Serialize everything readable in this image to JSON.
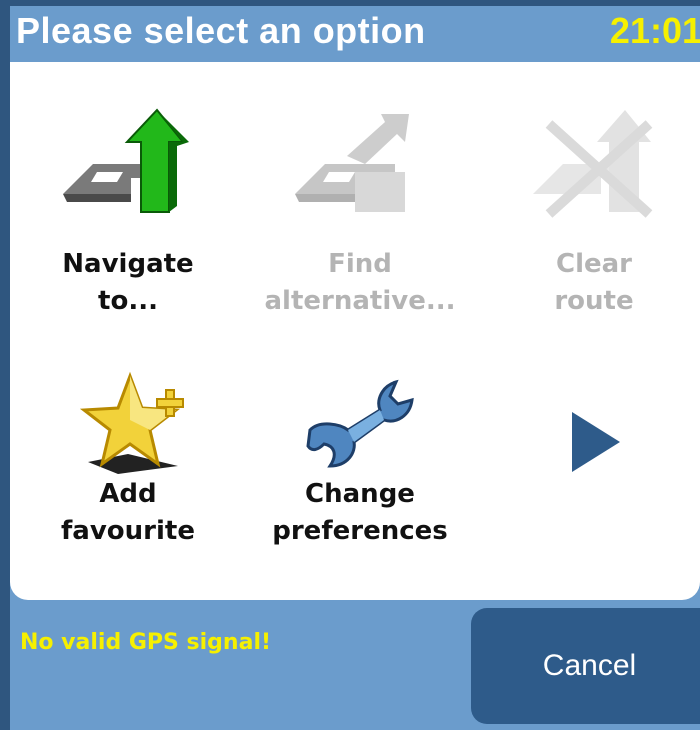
{
  "header": {
    "title": "Please select an option",
    "time": "21:01"
  },
  "menu": {
    "items": [
      {
        "line1": "Navigate",
        "line2": "to...",
        "icon": "navigate-arrow-icon",
        "enabled": true
      },
      {
        "line1": "Find",
        "line2": "alternative...",
        "icon": "find-alternative-icon",
        "enabled": false
      },
      {
        "line1": "Clear",
        "line2": "route",
        "icon": "clear-route-icon",
        "enabled": false
      },
      {
        "line1": "Add",
        "line2": "favourite",
        "icon": "star-plus-icon",
        "enabled": true
      },
      {
        "line1": "Change",
        "line2": "preferences",
        "icon": "wrench-icon",
        "enabled": true
      }
    ],
    "next_icon": "next-page-arrow-icon"
  },
  "status": {
    "message": "No valid GPS signal!"
  },
  "footer": {
    "cancel_label": "Cancel"
  },
  "colors": {
    "header_bg": "#6b9ccc",
    "clock": "#f6f000",
    "cancel_bg": "#2e5b8a",
    "status_text": "#f6f000"
  }
}
